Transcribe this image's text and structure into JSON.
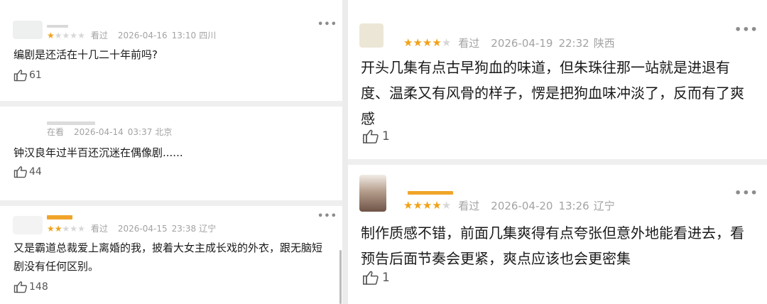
{
  "left_comments": [
    {
      "rating": 1,
      "status": "看过",
      "date": "2026-04-16",
      "time": "13:10",
      "location": "四川",
      "text": "编剧是还活在十几二十年前吗?",
      "likes": "61",
      "more": "•••",
      "avatar_color": "#eef0ef",
      "name_color": "#d9d9d9"
    },
    {
      "rating": 0,
      "status": "在看",
      "date": "2026-04-14",
      "time": "03:37",
      "location": "北京",
      "text": "钟汉良年过半百还沉迷在偶像剧......",
      "likes": "44",
      "more": "•••",
      "avatar_color": "#ffffff",
      "name_color": "#dcdcdc"
    },
    {
      "rating": 2,
      "status": "看过",
      "date": "2026-04-15",
      "time": "23:38",
      "location": "辽宁",
      "text": "又是霸道总裁爱上离婚的我，披着大女主成长戏的外衣，跟无脑短剧没有任何区别。",
      "likes": "148",
      "more": "•••",
      "avatar_color": "#f3f3f3",
      "name_color": "#f0a52a"
    }
  ],
  "right_comments": [
    {
      "rating": 4,
      "status": "看过",
      "date": "2026-04-19",
      "time": "22:32",
      "location": "陕西",
      "text": "开头几集有点古早狗血的味道，但朱珠往那一站就是进退有度、温柔又有风骨的样子，愣是把狗血味冲淡了，反而有了爽感",
      "likes": "1",
      "more": "•••",
      "avatar_color": "#ece6d6",
      "name_color": "#ffffff"
    },
    {
      "rating": 4,
      "status": "看过",
      "date": "2026-04-20",
      "time": "13:26",
      "location": "辽宁",
      "text": "制作质感不错，前面几集爽得有点夸张但意外地能看进去，看预告后面节奏会更紧，爽点应该也会更密集",
      "likes": "1",
      "more": "•••",
      "avatar_color": "#8a7266",
      "name_color": "#f0a52a"
    }
  ],
  "colors": {
    "star_on": "#f0a218",
    "star_off": "#d7d7d7",
    "meta_text": "#a3a3a3",
    "body_text": "#1a1a1a",
    "background": "#ffffff",
    "divider": "#ececec"
  },
  "icons": {
    "like": "thumbs-up-icon",
    "more": "more-dots-icon",
    "star": "star-icon"
  }
}
